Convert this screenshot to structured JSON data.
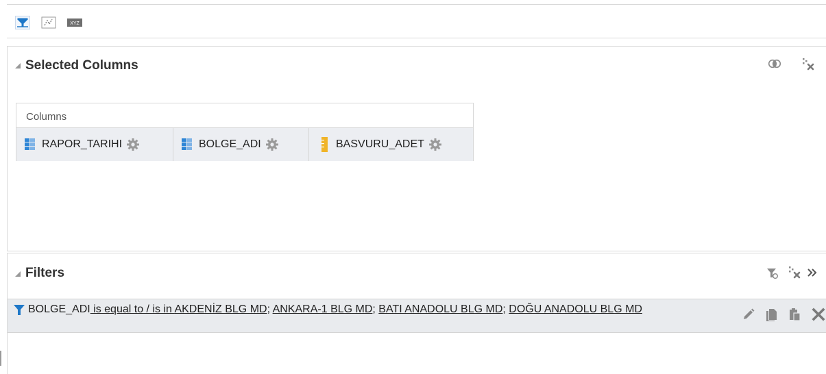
{
  "toolbar": {
    "items": [
      {
        "name": "filter-icon",
        "active": true
      },
      {
        "name": "edit-formula-icon",
        "active": false
      },
      {
        "name": "xyz-icon",
        "label": "XYZ",
        "active": false
      }
    ]
  },
  "selected_columns": {
    "title": "Selected Columns",
    "box_label": "Columns",
    "columns": [
      {
        "name": "RAPOR_TARIHI",
        "icon": "attribute-column-icon"
      },
      {
        "name": "BOLGE_ADI",
        "icon": "attribute-column-icon"
      },
      {
        "name": "BASVURU_ADET",
        "icon": "measure-column-icon"
      }
    ],
    "header_icons": [
      "combine-results-icon",
      "remove-all-columns-icon"
    ]
  },
  "filters": {
    "title": "Filters",
    "header_icons": [
      "add-filter-icon",
      "remove-all-filters-icon",
      "expand-more-icon"
    ],
    "rows": [
      {
        "column": "BOLGE_ADI",
        "operator": " is equal to / is in ",
        "values": [
          "AKDENİZ BLG MD",
          "ANKARA-1 BLG MD",
          "BATI ANADOLU BLG MD",
          "DOĞU ANADOLU BLG MD"
        ],
        "separator": "; "
      }
    ],
    "row_actions": [
      "edit-icon",
      "copy-icon",
      "paste-icon",
      "delete-icon"
    ]
  },
  "colors": {
    "accent_blue": "#1f78c8",
    "icon_gray": "#8a8a8a",
    "measure_yellow": "#f0b429",
    "panel_bg": "#ffffff",
    "row_bg": "#e9ebee"
  }
}
